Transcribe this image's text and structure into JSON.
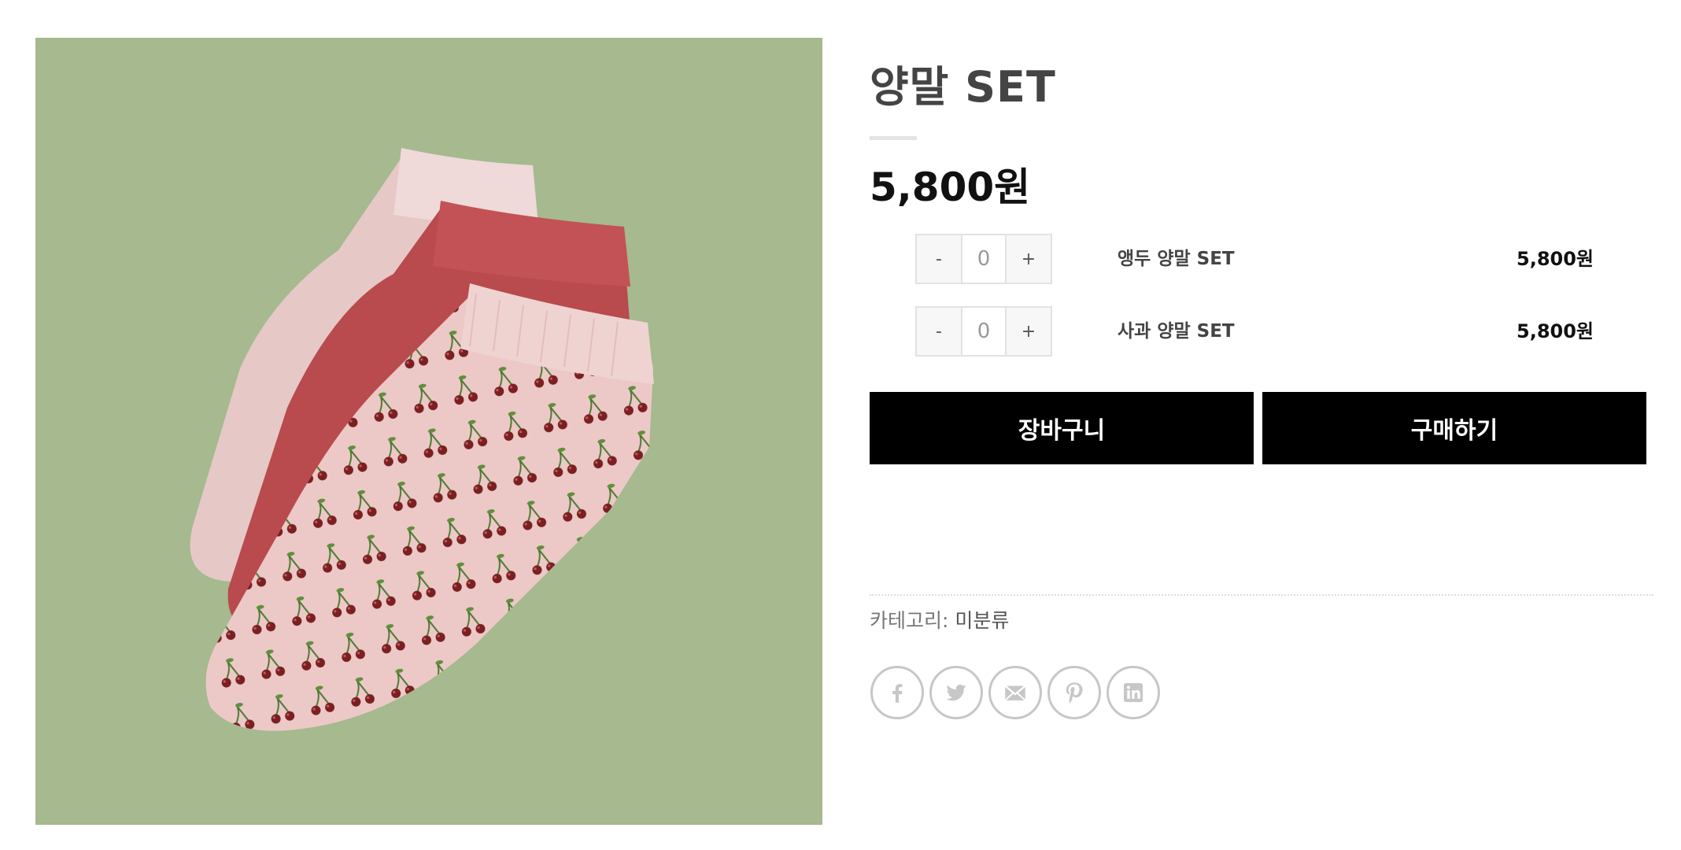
{
  "product": {
    "title": "양말 SET",
    "price": "5,800원",
    "image_alt": "Three ankle socks: plain pink, red, and pink with cherry pattern on a green background"
  },
  "options": [
    {
      "name": "앵두 양말 SET",
      "price": "5,800원",
      "quantity": "0",
      "minus_label": "-",
      "plus_label": "+"
    },
    {
      "name": "사과 양말 SET",
      "price": "5,800원",
      "quantity": "0",
      "minus_label": "-",
      "plus_label": "+"
    }
  ],
  "actions": {
    "cart_label": "장바구니",
    "buy_label": "구매하기"
  },
  "meta": {
    "category_prefix": "카테고리: ",
    "category_value": "미분류"
  },
  "share": {
    "icons": [
      "facebook-icon",
      "twitter-icon",
      "email-icon",
      "pinterest-icon",
      "linkedin-icon"
    ]
  },
  "colors": {
    "background_green": "#a6b98f",
    "sock_pink": "#ecc9c6",
    "sock_red": "#b94a4d",
    "cherry": "#7a1f22",
    "button_bg": "#000000",
    "share_icon_gray": "#c7c7c7"
  }
}
